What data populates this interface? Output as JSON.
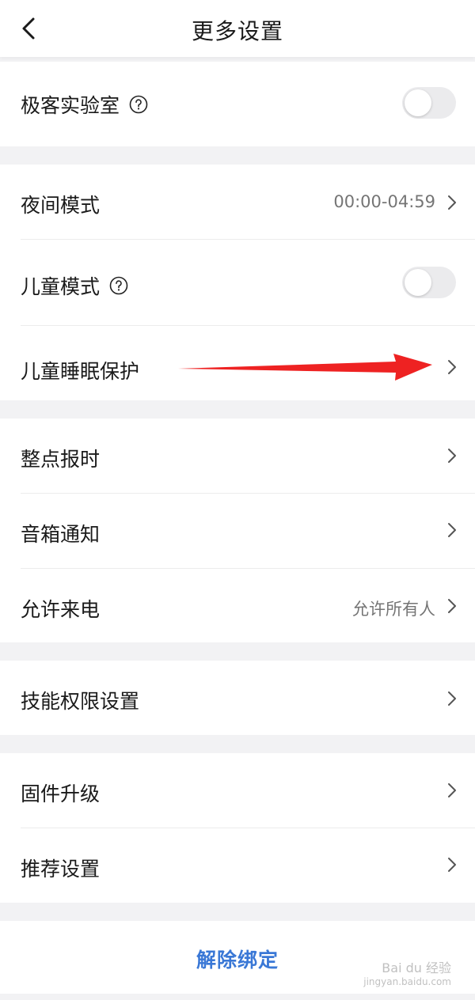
{
  "header": {
    "title": "更多设置"
  },
  "sections": {
    "geek_lab": {
      "label": "极客实验室"
    },
    "night_mode": {
      "label": "夜间模式",
      "value": "00:00-04:59"
    },
    "child_mode": {
      "label": "儿童模式"
    },
    "child_sleep": {
      "label": "儿童睡眠保护"
    },
    "hourly_chime": {
      "label": "整点报时"
    },
    "speaker_notify": {
      "label": "音箱通知"
    },
    "allow_calls": {
      "label": "允许来电",
      "value": "允许所有人"
    },
    "skill_permissions": {
      "label": "技能权限设置"
    },
    "firmware_upgrade": {
      "label": "固件升级"
    },
    "recommend_settings": {
      "label": "推荐设置"
    }
  },
  "unbind": {
    "label": "解除绑定"
  },
  "watermark": {
    "line1": "Bai du 经验",
    "line2": "jingyan.baidu.com"
  },
  "colors": {
    "accent": "#3a78d6",
    "annotation_arrow": "#ee2222",
    "toggle_off": "#ebebed"
  }
}
